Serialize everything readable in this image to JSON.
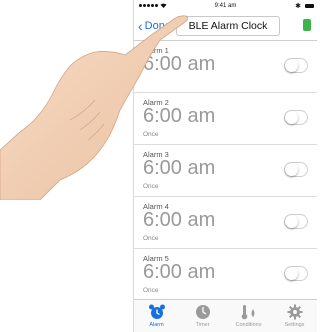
{
  "statusbar": {
    "time": "9:41 am",
    "bluetooth": "✱"
  },
  "nav": {
    "done_label": "Done",
    "title": "BLE Alarm Clock"
  },
  "alarms": [
    {
      "label": "Alarm 1",
      "time": "6:00 am",
      "repeat": "",
      "enabled": false
    },
    {
      "label": "Alarm 2",
      "time": "6:00 am",
      "repeat": "Once",
      "enabled": false
    },
    {
      "label": "Alarm 3",
      "time": "6:00 am",
      "repeat": "Once",
      "enabled": false
    },
    {
      "label": "Alarm 4",
      "time": "6:00 am",
      "repeat": "Once",
      "enabled": false
    },
    {
      "label": "Alarm 5",
      "time": "6:00 am",
      "repeat": "Once",
      "enabled": false
    }
  ],
  "tabs": [
    {
      "label": "Alarm",
      "icon": "alarm-clock-icon",
      "active": true
    },
    {
      "label": "Timer",
      "icon": "timer-icon",
      "active": false
    },
    {
      "label": "Conditions",
      "icon": "conditions-icon",
      "active": false
    },
    {
      "label": "Settings",
      "icon": "gear-icon",
      "active": false
    }
  ],
  "colors": {
    "accent": "#1a6fe0",
    "battery": "#3bb54a",
    "skin": "#f3d2b7"
  }
}
